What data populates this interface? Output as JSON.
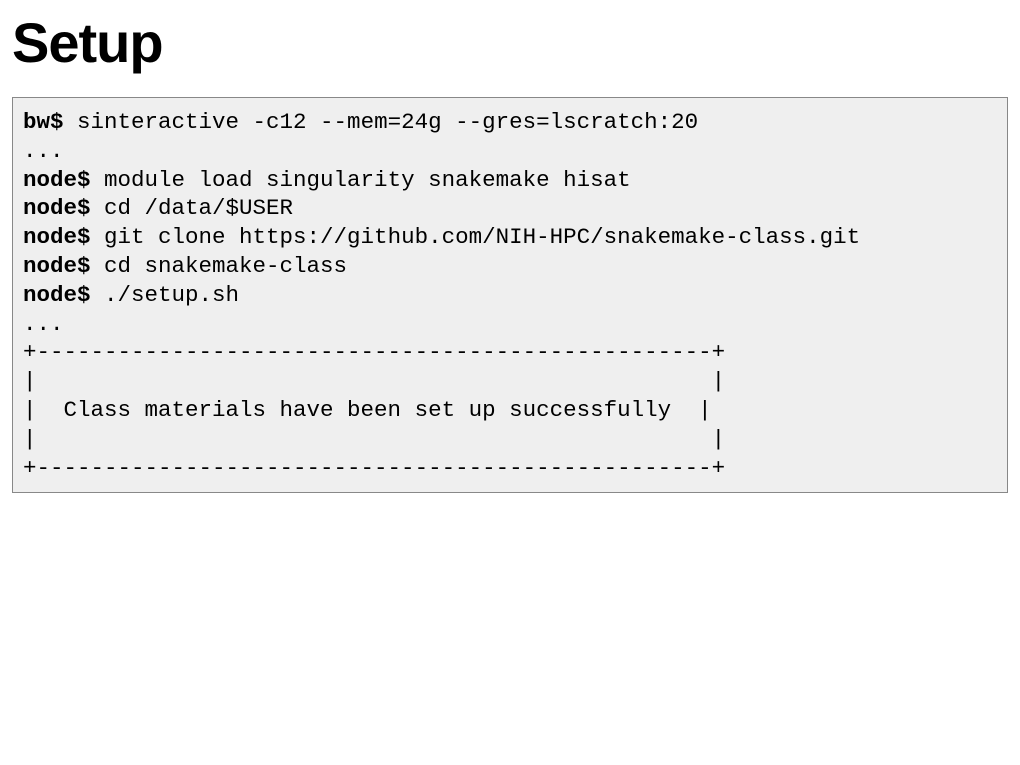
{
  "title": "Setup",
  "code": {
    "p1": "bw$",
    "c1": " sinteractive -c12 --mem=24g --gres=lscratch:20",
    "l2": "...",
    "p3": "node$",
    "c3": " module load singularity snakemake hisat",
    "p4": "node$",
    "c4": " cd /data/$USER",
    "p5": "node$",
    "c5": " git clone https://github.com/NIH-HPC/snakemake-class.git",
    "p6": "node$",
    "c6": " cd snakemake-class",
    "p7": "node$",
    "c7": " ./setup.sh",
    "l8": "...",
    "l9": "+--------------------------------------------------+",
    "l10": "|                                                  |",
    "l11": "|  Class materials have been set up successfully  |",
    "l12": "|                                                  |",
    "l13": "+--------------------------------------------------+"
  }
}
